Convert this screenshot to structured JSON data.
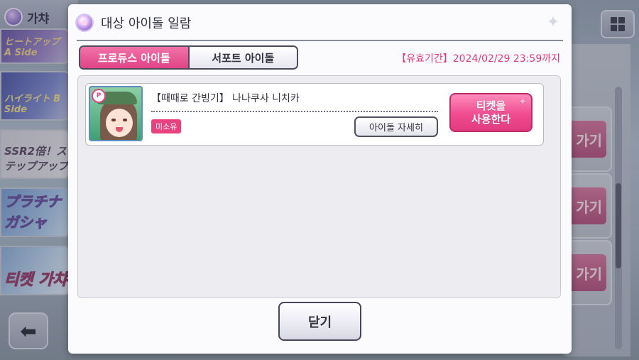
{
  "background": {
    "top_label": "가챠",
    "banners": [
      {
        "text": "ヒートアップ A Side"
      },
      {
        "text": "ハイライト B Side"
      },
      {
        "text": "SSR2倍！ステップアップ"
      },
      {
        "text": "プラチナガシャ"
      },
      {
        "text": "티켓 가챠"
      }
    ],
    "right_cards": [
      "가기",
      "가기",
      "가기"
    ]
  },
  "dialog": {
    "title": "대상 아이돌 일람",
    "tabs": [
      {
        "label": "프로듀스 아이돌",
        "active": true
      },
      {
        "label": "서포트 아이돌",
        "active": false
      }
    ],
    "expiry": "【유효기간】2024/02/29 23:59까지",
    "idols": [
      {
        "name": "【때때로 간빙기】 나나쿠사 니치카",
        "type_badge": "P",
        "status": "미소유",
        "detail_label": "아이돌 자세히",
        "use_ticket_label_line1": "티켓을",
        "use_ticket_label_line2": "사용한다"
      }
    ],
    "close_label": "닫기"
  },
  "colors": {
    "accent_pink": "#e8417e",
    "tab_active": "#f272a8",
    "expiry_text": "#e03b7c"
  }
}
